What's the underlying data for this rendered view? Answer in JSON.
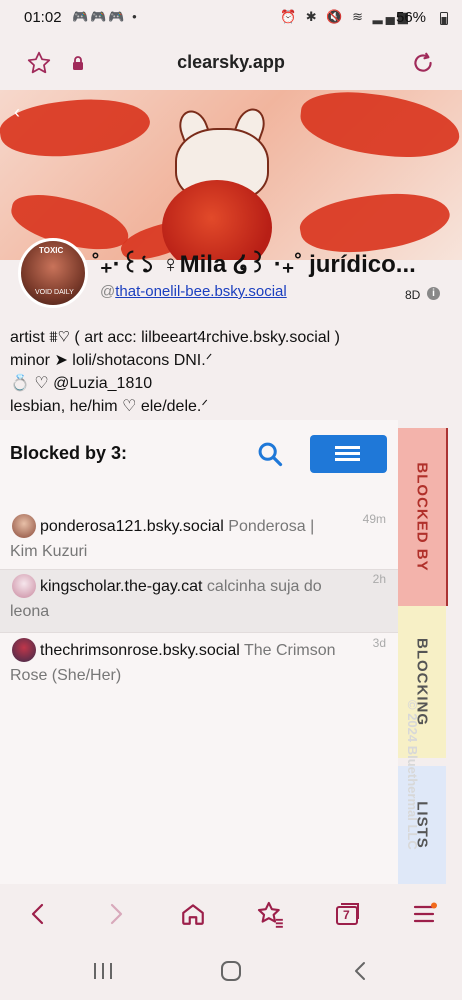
{
  "status_bar": {
    "time": "01:02",
    "battery": "56%"
  },
  "browser": {
    "url": "clearsky.app"
  },
  "profile": {
    "display_name": "˚₊·꒰১ ♀Mila ໒꒱ ·₊˚ jurídico...",
    "handle_prefix": "@",
    "handle": "that-onelil-bee.bsky.social",
    "age": "8D",
    "avatar_text_top": "TOXIC",
    "avatar_text_bottom": "VOID DAILY",
    "bio": [
      "artist ⩩♡ ( art acc: lilbeeart4rchive.bsky.social )",
      "minor ➤ loli/shotacons DNI.ᐟ",
      "💍 ♡ @Luzia_1810",
      "lesbian, he/him ♡ ele/dele.ᐟ"
    ]
  },
  "blocked": {
    "title": "Blocked by 3:",
    "rows": [
      {
        "handle": "ponderosa121.bsky.social",
        "name": "Ponderosa | Kim Kuzuri",
        "time": "49m"
      },
      {
        "handle": "kingscholar.the-gay.cat",
        "name": "calcinha suja do leona",
        "time": "2h"
      },
      {
        "handle": "thechrimsonrose.bsky.social",
        "name": "The Crimson Rose (She/Her)",
        "time": "3d"
      }
    ]
  },
  "side_tabs": {
    "blocked_by": "BLOCKED BY",
    "blocking": "BLOCKING",
    "lists": "LISTS"
  },
  "copyright": "© 2024 Bluethermal LLC",
  "bottom_nav": {
    "tabs_count": "7"
  },
  "colors": {
    "accent": "#1f78d8",
    "brand": "#9c1f4a",
    "blocked_tab": "#f3b3ab",
    "blocking_tab": "#f7f0c6",
    "lists_tab": "#dfe8f8"
  }
}
